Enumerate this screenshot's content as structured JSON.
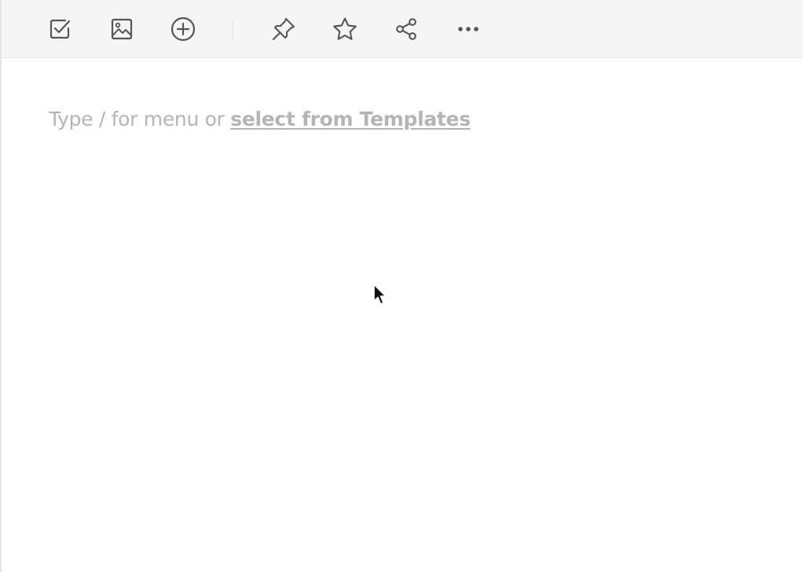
{
  "toolbar": {
    "buttons": [
      {
        "name": "checklist",
        "icon": "checkbox-icon"
      },
      {
        "name": "image",
        "icon": "image-icon"
      },
      {
        "name": "add",
        "icon": "plus-circle-icon"
      },
      {
        "name": "pin",
        "icon": "pin-icon"
      },
      {
        "name": "favorite",
        "icon": "star-icon"
      },
      {
        "name": "share",
        "icon": "share-icon"
      },
      {
        "name": "more",
        "icon": "ellipsis-icon"
      }
    ],
    "icon_color": "#555555"
  },
  "editor": {
    "placeholder_text": "Type / for menu or ",
    "templates_link": "select from Templates",
    "placeholder_color": "#b4b4b4"
  }
}
